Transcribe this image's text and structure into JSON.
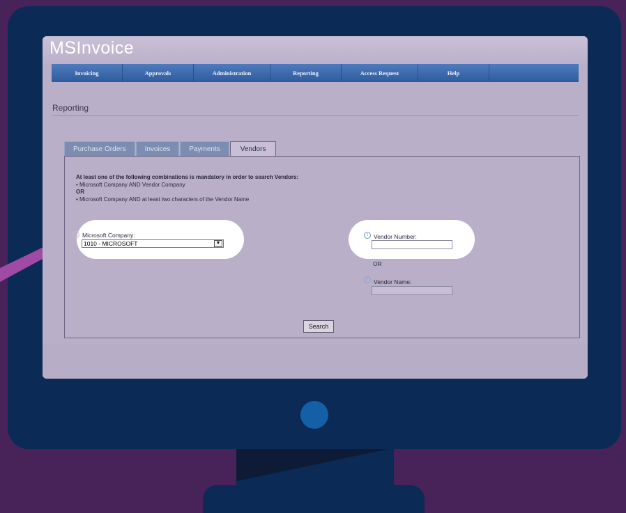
{
  "app": {
    "title": "MSInvoice"
  },
  "nav": {
    "items": [
      "Invoicing",
      "Approvals",
      "Administration",
      "Reporting",
      "Access Request",
      "Help"
    ]
  },
  "page": {
    "title": "Reporting"
  },
  "tabs": [
    {
      "label": "Purchase Orders",
      "active": false
    },
    {
      "label": "Invoices",
      "active": false
    },
    {
      "label": "Payments",
      "active": false
    },
    {
      "label": "Vendors",
      "active": true
    }
  ],
  "instructions": {
    "heading": "At least one of the following combinations is mandatory in order to search Vendors:",
    "line1": "• Microsoft Company AND Vendor Company",
    "or": "OR",
    "line2": "• Microsoft Company AND at least two characters of the Vendor Name"
  },
  "form": {
    "company_label": "Microsoft Company:",
    "company_value": "1010 - MICROSOFT",
    "vendor_number_label": "Vendor Number:",
    "vendor_number_value": "",
    "or_label": "OR",
    "vendor_name_label": "Vendor Name:",
    "vendor_name_value": "",
    "search_label": "Search"
  },
  "icons": {
    "info": "info-icon",
    "dropdown": "chevron-down-icon",
    "power": "power-button-icon"
  },
  "colors": {
    "background": "#47235a",
    "monitor": "#0b2a55",
    "power_button": "#1460a7",
    "nav_bar": "#2e5b9f",
    "pointer": "#a04aa6"
  }
}
